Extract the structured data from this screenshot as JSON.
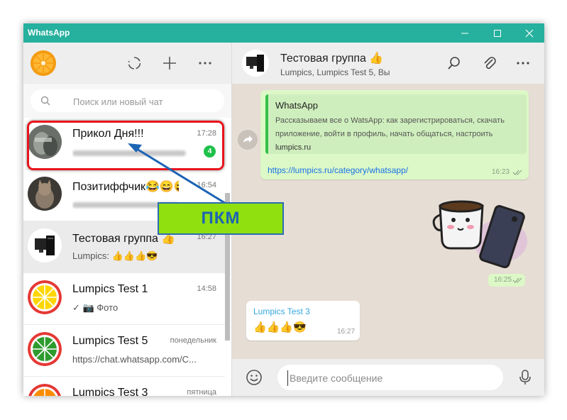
{
  "window": {
    "title": "WhatsApp",
    "minimize_icon": "minimize-icon",
    "maximize_icon": "maximize-icon",
    "close_icon": "close-icon"
  },
  "sidebar": {
    "header_icons": [
      "refresh-status-icon",
      "new-chat-icon",
      "menu-icon"
    ],
    "search": {
      "placeholder": "Поиск или новый чат"
    },
    "chats": [
      {
        "name": "Прикол Дня!!!",
        "time": "17:28",
        "preview": "",
        "unread": "4"
      },
      {
        "name": "Позитиффчик😂😄😜",
        "time": "16:54",
        "preview": "",
        "unread": ""
      },
      {
        "name": "Тестовая группа 👍",
        "time": "16:27",
        "preview": "Lumpics: 👍👍👍😎",
        "unread": ""
      },
      {
        "name": "Lumpics Test 1",
        "time": "14:58",
        "preview": "✓ 📷 Фото",
        "unread": ""
      },
      {
        "name": "Lumpics Test 5",
        "time": "понедельник",
        "preview": "https://chat.whatsapp.com/C...",
        "unread": ""
      },
      {
        "name": "Lumpics Test 3",
        "time": "пятница",
        "preview": "",
        "unread": ""
      }
    ]
  },
  "conversation": {
    "title": "Тестовая группа 👍",
    "members": "Lumpics, Lumpics Test 5, Вы",
    "messages": [
      {
        "preview_title": "WhatsApp",
        "preview_desc": "Рассказываем все о WatsApp: как зарегистрироваться, скачать приложение, войти в профиль, начать общаться, настроить",
        "preview_site": "lumpics.ru",
        "link": "https://lumpics.ru/category/whatsapp/",
        "time": "16:23"
      },
      {
        "type": "sticker",
        "time": "16:25"
      },
      {
        "sender": "Lumpics Test 3",
        "text": "👍👍👍😎",
        "time": "16:27"
      }
    ],
    "composer": {
      "placeholder": "Введите сообщение"
    }
  },
  "annotation": {
    "label": "ПКМ"
  },
  "colors": {
    "titlebar": "#26b09e",
    "badge": "#1fc14a",
    "outgoing_bubble": "#dcf8c6",
    "annotation_box": "#e8141c",
    "annotation_label_bg": "#90e010"
  }
}
